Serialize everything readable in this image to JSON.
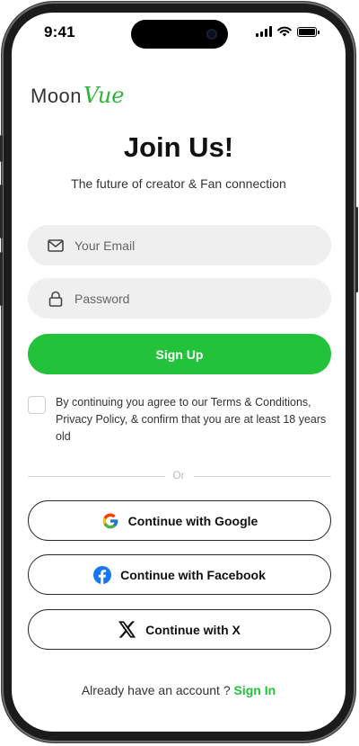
{
  "status_bar": {
    "time": "9:41"
  },
  "logo": {
    "part1": "Moon",
    "part2": "Vue"
  },
  "heading": {
    "title": "Join Us!",
    "subtitle": "The future of creator & Fan connection"
  },
  "form": {
    "email": {
      "placeholder": "Your Email",
      "value": "",
      "icon": "mail-icon"
    },
    "password": {
      "placeholder": "Password",
      "value": "",
      "icon": "lock-icon"
    },
    "signup_label": "Sign Up",
    "terms_checked": false,
    "terms_text": "By continuing you agree to our Terms & Conditions, Privacy Policy, & confirm that you are at least 18 years old"
  },
  "divider_text": "Or",
  "social": {
    "google_label": "Continue with Google",
    "facebook_label": "Continue with Facebook",
    "x_label": "Continue with X"
  },
  "footer": {
    "prompt": "Already have an account ?",
    "link": "Sign In"
  },
  "colors": {
    "brand_green": "#22c33a",
    "field_bg": "#efefef",
    "text_dark": "#111111"
  }
}
